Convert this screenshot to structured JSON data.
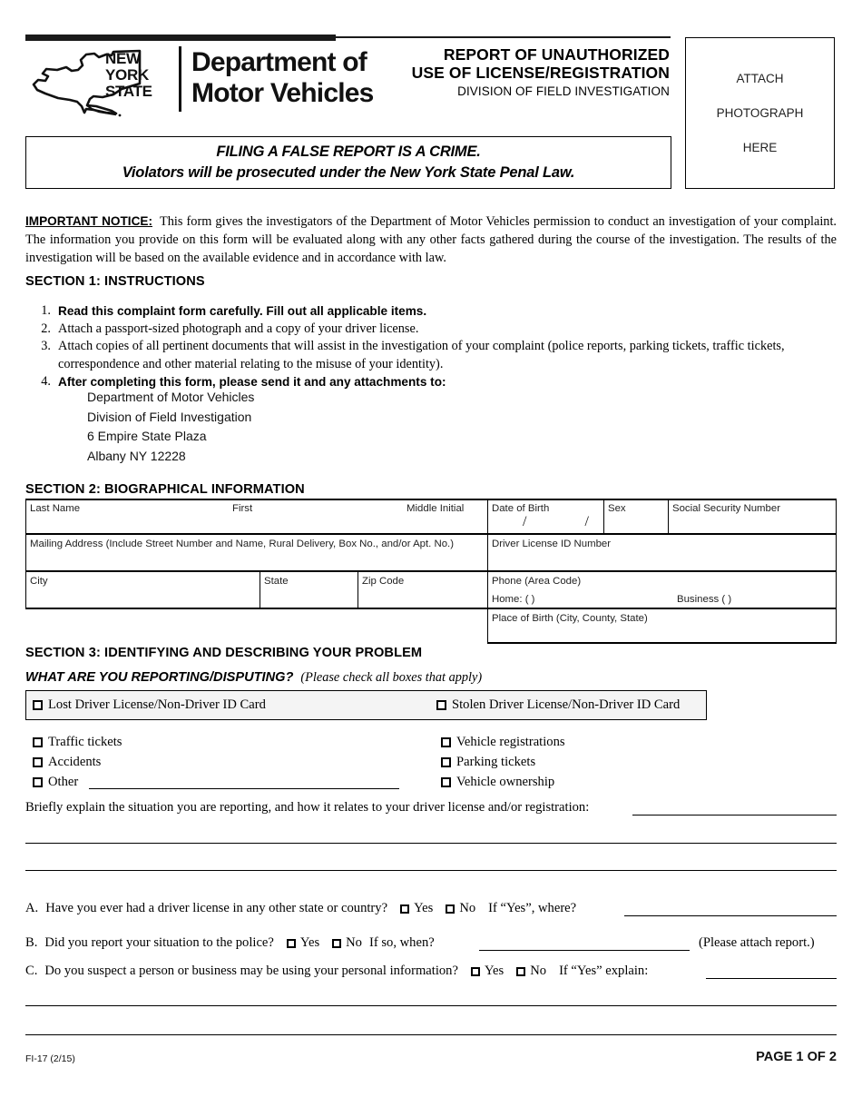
{
  "header": {
    "agency_state": "NEW\nYORK\nSTATE",
    "agency_state_lines": [
      "NEW",
      "YORK",
      "STATE"
    ],
    "agency_name_line1": "Department of",
    "agency_name_line2": "Motor Vehicles",
    "title_line1": "REPORT OF UNAUTHORIZED",
    "title_line2": "USE OF LICENSE/REGISTRATION",
    "subtitle": "DIVISION OF FIELD INVESTIGATION",
    "photo_box": {
      "line1": "ATTACH",
      "line2": "PHOTOGRAPH",
      "line3": "HERE"
    }
  },
  "crime_notice": {
    "line1": "FILING A FALSE REPORT IS A CRIME.",
    "line2": "Violators will be prosecuted under the New York State Penal Law."
  },
  "important_notice": {
    "label": "IMPORTANT NOTICE:",
    "body": "This form gives the investigators of the Department of Motor Vehicles permission to conduct an investigation of your complaint. The information you provide on this form will be evaluated along with any other facts gathered during the course of the investigation. The results of the investigation will be based on the available evidence and in accordance with law."
  },
  "section1": {
    "heading": "SECTION 1:  INSTRUCTIONS",
    "items": [
      {
        "num": "1.",
        "text": "Read this complaint form carefully. Fill out all applicable items.",
        "bold": true
      },
      {
        "num": "2.",
        "text": "Attach a passport-sized photograph and a copy of your driver license.",
        "bold": false
      },
      {
        "num": "3.",
        "text": "Attach copies of all pertinent documents that will assist in the investigation of your complaint (police reports, parking tickets, traffic tickets, correspondence and other material relating to the misuse of your identity).",
        "bold": false
      },
      {
        "num": "4.",
        "text": "After completing this form, please send it and any attachments to:",
        "bold": true
      }
    ],
    "address": [
      "Department of Motor Vehicles",
      "Division of Field Investigation",
      "6 Empire State Plaza",
      "Albany NY 12228"
    ]
  },
  "section2": {
    "heading": "SECTION 2:  BIOGRAPHICAL INFORMATION",
    "labels": {
      "last_name": "Last Name",
      "first": "First",
      "middle_initial": "Middle Initial",
      "date_of_birth": "Date of Birth",
      "dob_separator": "/",
      "sex": "Sex",
      "ssn": "Social Security Number",
      "mailing_address": "Mailing Address (Include Street Number and Name, Rural Delivery, Box No.,  and/or Apt. No.)",
      "driver_license_id": "Driver License ID Number",
      "city": "City",
      "state": "State",
      "zip_code": "Zip Code",
      "phone": "Phone (Area Code)",
      "home_phone": "Home: (                )",
      "business_phone": "Business (            )",
      "place_of_birth": "Place of Birth (City, County, State)"
    },
    "values": {
      "last_name": "",
      "first": "",
      "middle_initial": "",
      "date_of_birth": "",
      "sex": "",
      "ssn": "",
      "mailing_address": "",
      "driver_license_id": "",
      "city": "",
      "state": "",
      "zip_code": "",
      "home_phone": "",
      "business_phone": "",
      "place_of_birth": ""
    }
  },
  "section3": {
    "heading": "SECTION 3:  IDENTIFYING AND DESCRIBING YOUR PROBLEM",
    "question": "WHAT ARE YOU REPORTING/DISPUTING?",
    "question_sub": "(Please check all boxes that apply)",
    "highlight_options": [
      {
        "label": "Lost Driver License/Non-Driver ID Card",
        "checked": false
      },
      {
        "label": "Stolen Driver License/Non-Driver ID Card",
        "checked": false
      }
    ],
    "options_left": [
      {
        "label": "Traffic tickets",
        "checked": false
      },
      {
        "label": "Accidents",
        "checked": false
      },
      {
        "label": "Other",
        "checked": false
      }
    ],
    "options_right": [
      {
        "label": "Vehicle registrations",
        "checked": false
      },
      {
        "label": "Parking tickets",
        "checked": false
      },
      {
        "label": "Vehicle ownership",
        "checked": false
      }
    ],
    "other_value": "",
    "explain_prompt": "Briefly explain the situation you are reporting, and how it relates to your driver license and/or registration:",
    "explain_value": "",
    "questions": [
      {
        "letter": "A.",
        "text": "Have you ever had a driver license in any other state or country?",
        "yes": "Yes",
        "no": "No",
        "yes_checked": false,
        "no_checked": false,
        "followup": "If “Yes”, where?",
        "followup_value": "",
        "note": ""
      },
      {
        "letter": "B.",
        "text": "Did you report your situation to the police?",
        "yes": "Yes",
        "no": "No",
        "yes_checked": false,
        "no_checked": false,
        "followup": "If so, when?",
        "followup_value": "",
        "note": "(Please attach report.)"
      },
      {
        "letter": "C.",
        "text": "Do you suspect a person or business may be using your personal information?",
        "yes": "Yes",
        "no": "No",
        "yes_checked": false,
        "no_checked": false,
        "followup": "If “Yes” explain:",
        "followup_value": "",
        "note": ""
      }
    ]
  },
  "footer": {
    "form_code": "FI-17 (2/15)",
    "page_label": "PAGE 1 OF 2"
  },
  "colors": {
    "ink": "#000000",
    "rule": "#1a1a1a",
    "highlight_fill": "#f4f4f4",
    "page_bg": "#ffffff"
  }
}
